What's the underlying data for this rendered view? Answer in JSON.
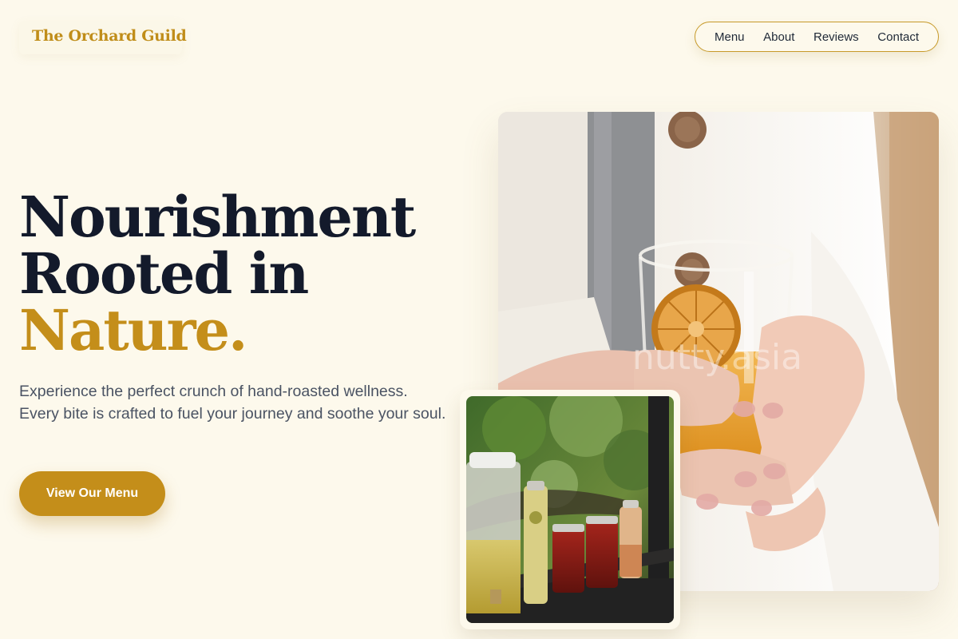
{
  "header": {
    "brand": "The Orchard Guild",
    "nav": [
      "Menu",
      "About",
      "Reviews",
      "Contact"
    ]
  },
  "hero": {
    "headline_line1": "Nourishment",
    "headline_line2": "Rooted in",
    "headline_accent": "Nature.",
    "description": "Experience the perfect crunch of hand-roasted wellness. Every bite is crafted to fuel your journey and soothe your soul.",
    "cta_label": "View Our Menu"
  },
  "images": {
    "hero_photo": "person-holding-orange-drink-photo",
    "hero_watermark": "nutty.asia",
    "inset_photo": "bottled-drinks-on-shelf-photo"
  },
  "colors": {
    "background": "#fdf9ec",
    "accent": "#c48e1a",
    "headline": "#131a2b",
    "body_text": "#4a5363"
  }
}
